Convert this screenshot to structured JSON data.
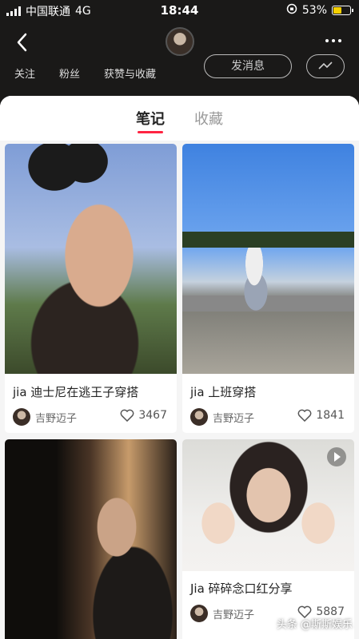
{
  "status_bar": {
    "carrier": "中国联通",
    "network": "4G",
    "time": "18:44",
    "battery": "53%"
  },
  "header": {
    "stats": [
      "关注",
      "粉丝",
      "获赞与收藏"
    ],
    "message_button": "发消息",
    "icons": [
      "back-icon",
      "more-icon",
      "switch-account-icon"
    ]
  },
  "tabs": [
    {
      "label": "笔记",
      "active": true
    },
    {
      "label": "收藏",
      "active": false
    }
  ],
  "notes": [
    {
      "title": "jia 迪士尼在逃王子穿搭",
      "author": "吉野迈子",
      "likes": "3467",
      "video": false
    },
    {
      "title": "jia 上班穿搭",
      "author": "吉野迈子",
      "likes": "1841",
      "video": false
    },
    {
      "title": "",
      "author": "",
      "likes": "",
      "video": false
    },
    {
      "title": "Jia 碎碎念口红分享",
      "author": "吉野迈子",
      "likes": "5887",
      "video": true
    }
  ],
  "watermark": "头条 @斯斯娱乐",
  "colors": {
    "accent": "#ff2442",
    "background_dark": "#1a1918",
    "sheet": "#f5f5f5"
  }
}
